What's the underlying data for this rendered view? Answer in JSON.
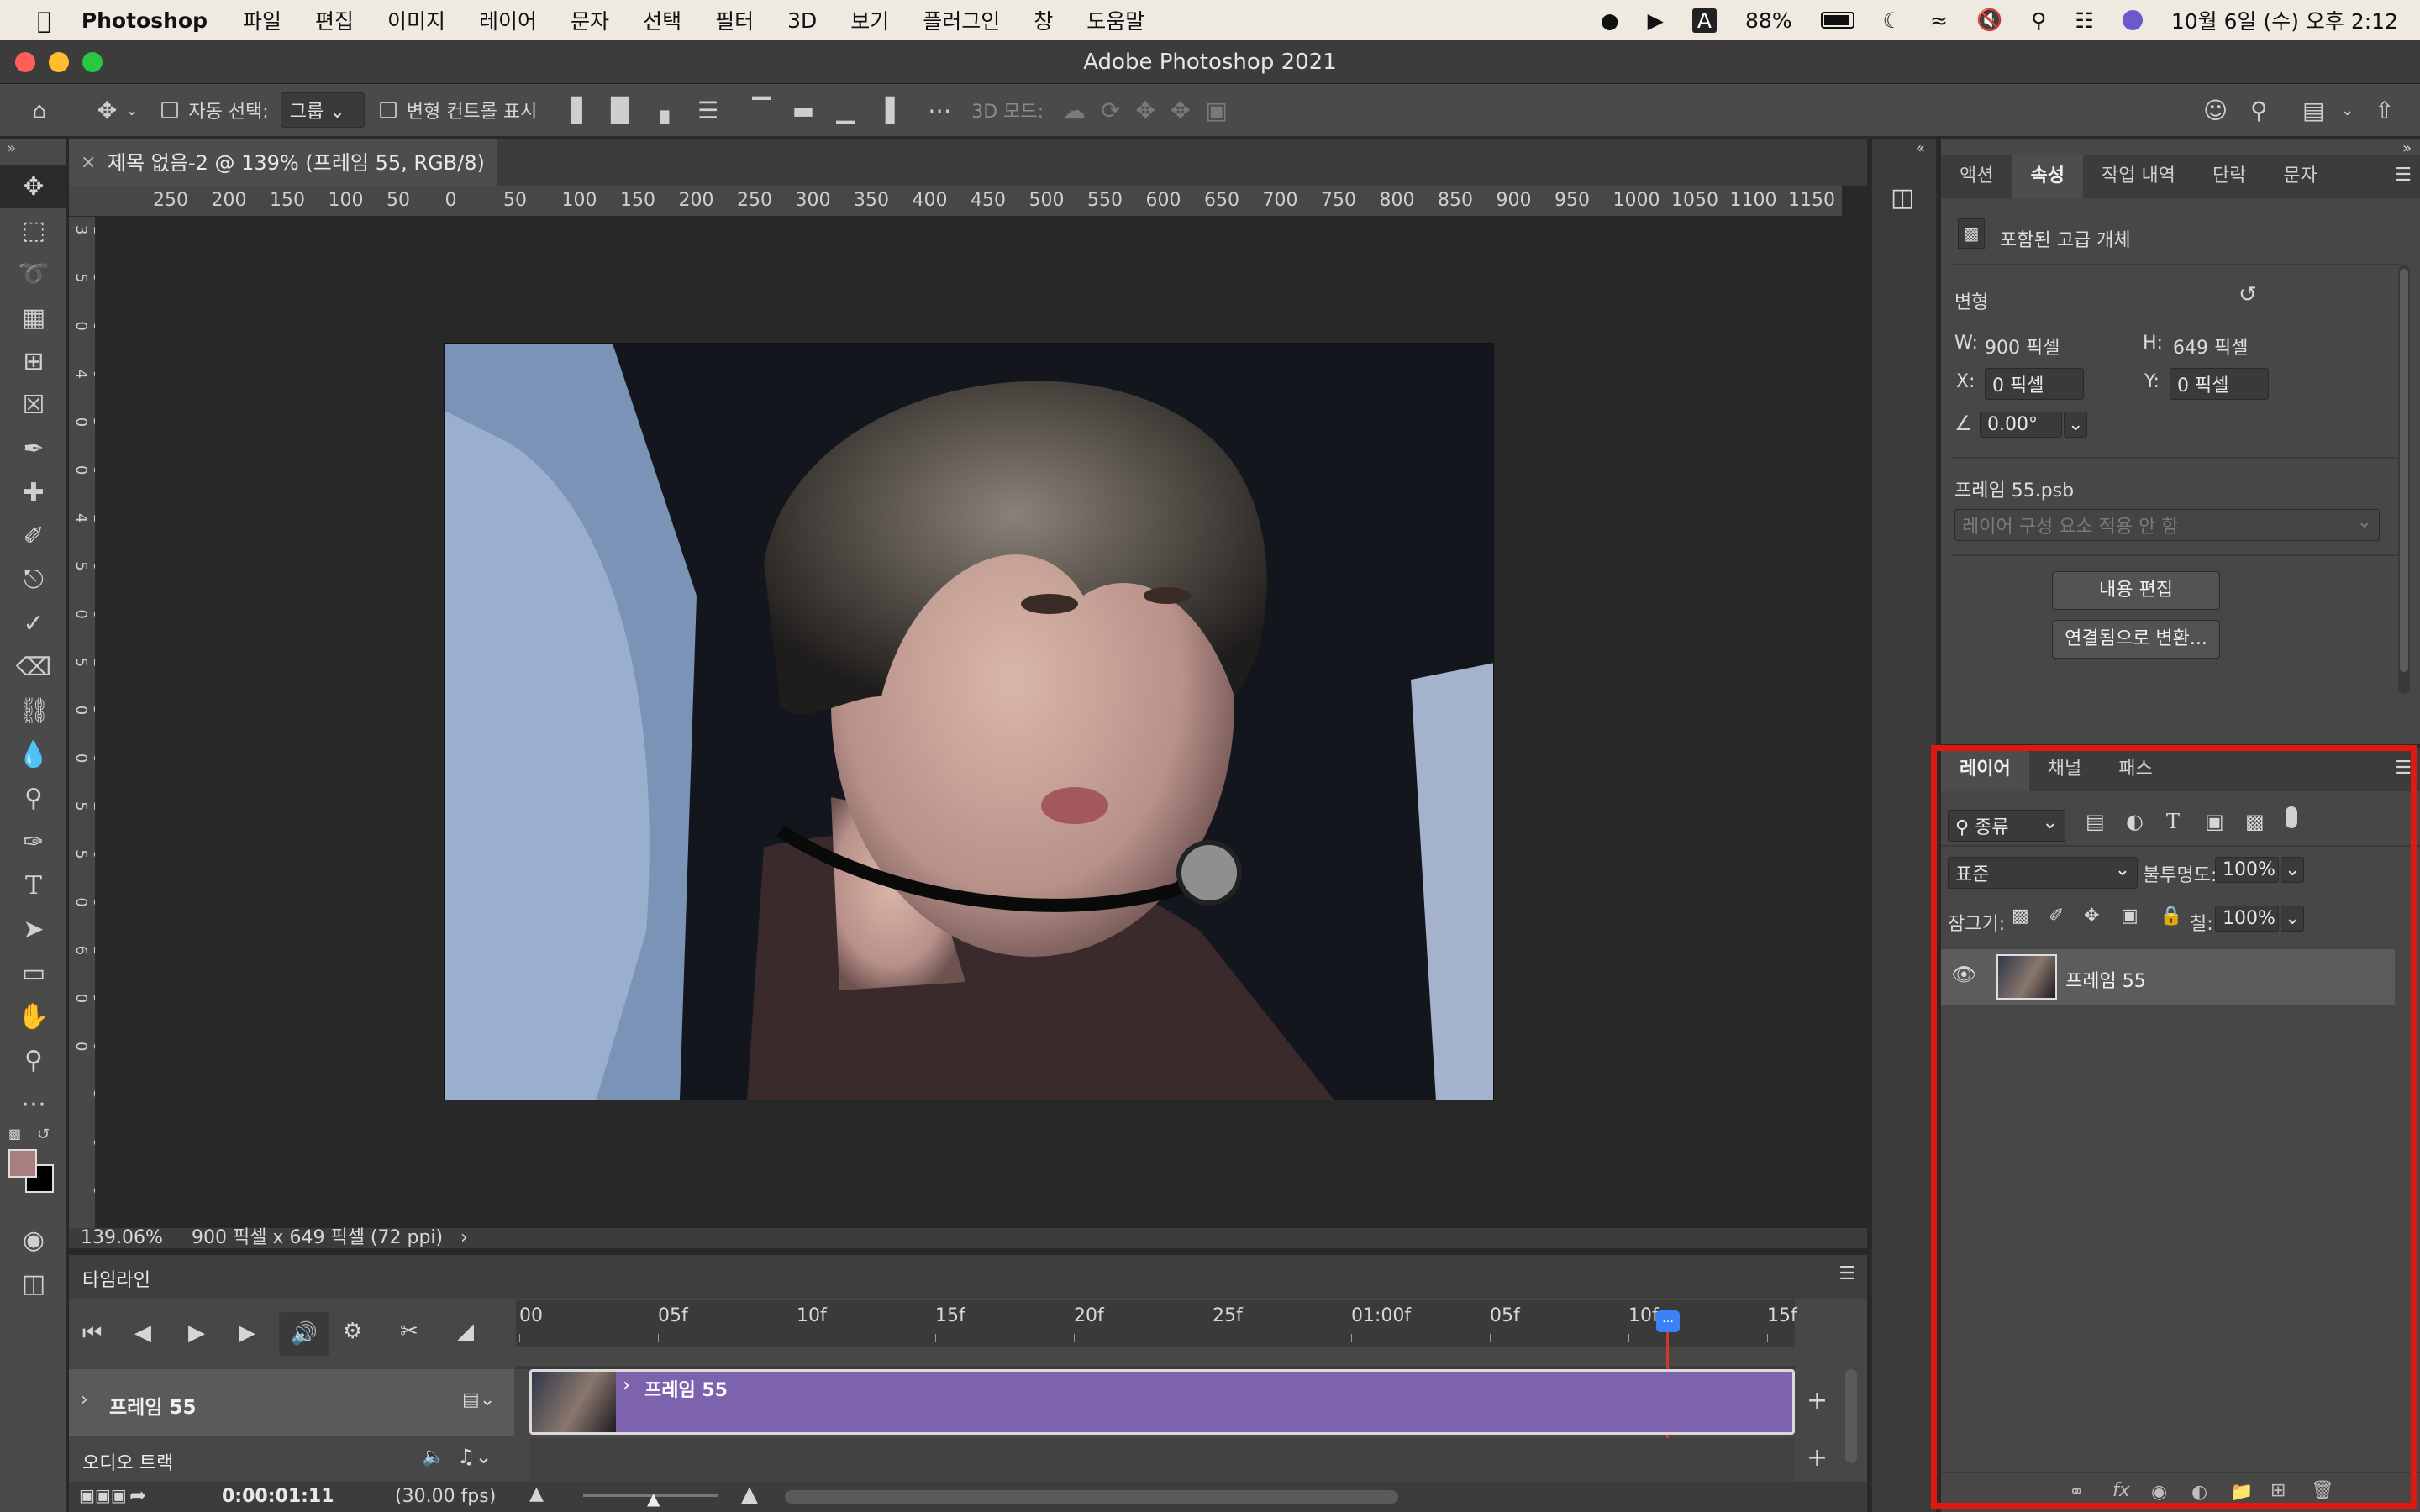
{
  "menubar": {
    "app": "Photoshop",
    "items": [
      "파일",
      "편집",
      "이미지",
      "레이어",
      "문자",
      "선택",
      "필터",
      "3D",
      "보기",
      "플러그인",
      "창",
      "도움말"
    ],
    "battery": "88%",
    "datetime": "10월 6일 (수) 오후 2:12",
    "input_method": "A"
  },
  "window": {
    "title": "Adobe Photoshop 2021"
  },
  "options": {
    "auto_select_label": "자동 선택:",
    "auto_select_value": "그룹",
    "transform_controls_label": "변형 컨트롤 표시",
    "mode_3d_label": "3D 모드:"
  },
  "document": {
    "tab_title": "제목 없음-2 @ 139% (프레임 55, RGB/8) *",
    "zoom": "139.06%",
    "dimensions": "900 픽셀 x 649 픽셀 (72 ppi)"
  },
  "ruler": {
    "h_ticks": [
      "250",
      "200",
      "150",
      "100",
      "50",
      "0",
      "50",
      "100",
      "150",
      "200",
      "250",
      "300",
      "350",
      "400",
      "450",
      "500",
      "550",
      "600",
      "650",
      "700",
      "750",
      "800",
      "850",
      "900",
      "950",
      "1000",
      "1050",
      "1100",
      "1150"
    ]
  },
  "timeline": {
    "title": "타임라인",
    "ticks": [
      "00",
      "05f",
      "10f",
      "15f",
      "20f",
      "25f",
      "01:00f",
      "05f",
      "10f",
      "15f"
    ],
    "track_name": "프레임 55",
    "clip_name": "프레임 55",
    "audio_track": "오디오 트랙",
    "timecode": "0:00:01:11",
    "fps": "(30.00 fps)"
  },
  "properties": {
    "tabs": [
      "액션",
      "속성",
      "작업 내역",
      "단락",
      "문자"
    ],
    "active_tab": "속성",
    "object_type": "포함된 고급 개체",
    "transform_label": "변형",
    "w_label": "W:",
    "w_value": "900 픽셀",
    "h_label": "H:",
    "h_value": "649 픽셀",
    "x_label": "X:",
    "x_value": "0 픽셀",
    "y_label": "Y:",
    "y_value": "0 픽셀",
    "angle": "0.00°",
    "file_name": "프레임 55.psb",
    "comp_placeholder": "레이어 구성 요소 적용 안 함",
    "edit_contents": "내용 편집",
    "convert_linked": "연결됨으로 변환..."
  },
  "layers": {
    "tabs": [
      "레이어",
      "채널",
      "패스"
    ],
    "filter_kind": "종류",
    "blend_mode": "표준",
    "opacity_label": "불투명도:",
    "opacity": "100%",
    "lock_label": "잠그기:",
    "fill_label": "칠:",
    "fill": "100%",
    "items": [
      {
        "name": "프레임 55"
      }
    ]
  }
}
